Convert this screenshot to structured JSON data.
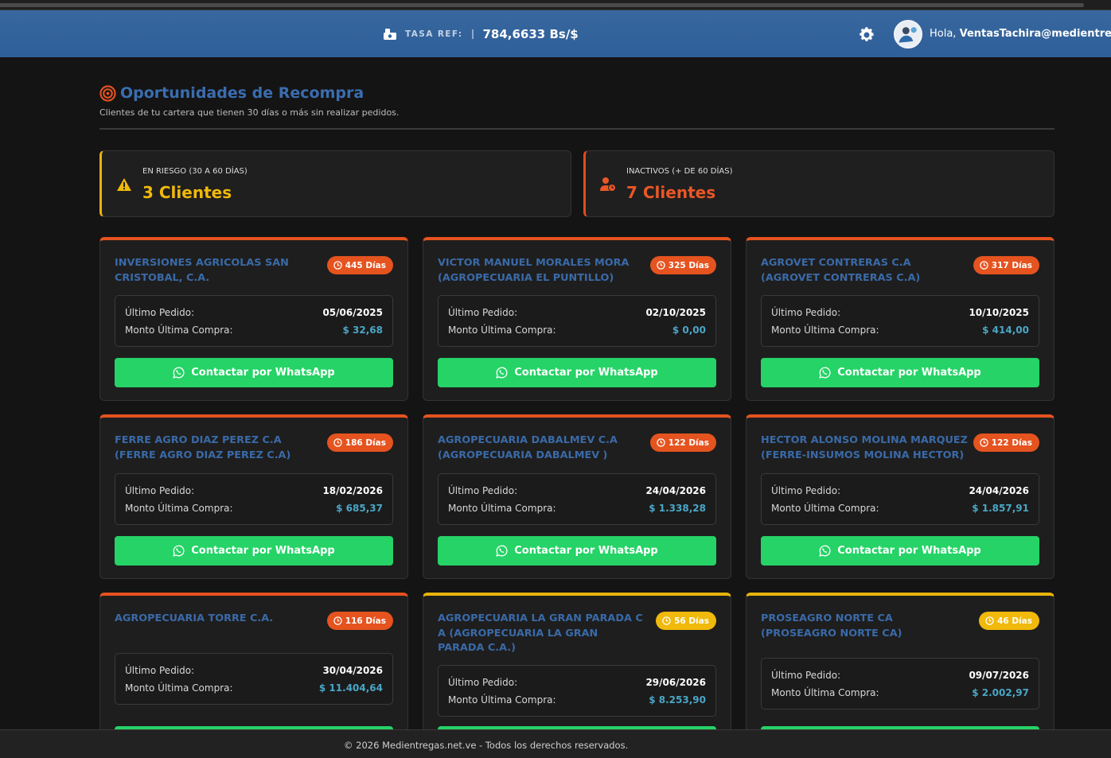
{
  "header": {
    "rate_label": "TASA REF:",
    "rate_value": "784,6633 Bs/$",
    "greeting_prefix": "Hola,",
    "user": "VentasTachira@medientregas"
  },
  "page": {
    "title": "Oportunidades de Recompra",
    "subtitle": "Clientes de tu cartera que tienen 30 días o más sin realizar pedidos."
  },
  "stats": {
    "risk_label": "EN RIESGO (30 A 60 DÍAS)",
    "risk_value": "3 Clientes",
    "inactive_label": "INACTIVOS (+ DE 60 DÍAS)",
    "inactive_value": "7 Clientes"
  },
  "labels": {
    "last_order": "Último Pedido:",
    "last_amount": "Monto Última Compra:",
    "whatsapp": "Contactar por WhatsApp"
  },
  "clients": [
    {
      "name": "INVERSIONES AGRICOLAS SAN CRISTOBAL, C.A.",
      "days": "445 Días",
      "date": "05/06/2025",
      "amount": "$ 32,68"
    },
    {
      "name": "VICTOR MANUEL MORALES MORA (AGROPECUARIA EL PUNTILLO)",
      "days": "325 Días",
      "date": "02/10/2025",
      "amount": "$ 0,00"
    },
    {
      "name": "AGROVET CONTRERAS C.A (AGROVET CONTRERAS C.A)",
      "days": "317 Días",
      "date": "10/10/2025",
      "amount": "$ 414,00"
    },
    {
      "name": "FERRE AGRO DIAZ PEREZ C.A (FERRE AGRO DIAZ PEREZ C.A)",
      "days": "186 Días",
      "date": "18/02/2026",
      "amount": "$ 685,37"
    },
    {
      "name": "AGROPECUARIA DABALMEV C.A (AGROPECUARIA DABALMEV )",
      "days": "122 Días",
      "date": "24/04/2026",
      "amount": "$ 1.338,28"
    },
    {
      "name": "HECTOR ALONSO MOLINA MARQUEZ (FERRE-INSUMOS MOLINA HECTOR)",
      "days": "122 Días",
      "date": "24/04/2026",
      "amount": "$ 1.857,91"
    },
    {
      "name": "AGROPECUARIA TORRE C.A.",
      "days": "116 Días",
      "date": "30/04/2026",
      "amount": "$ 11.404,64"
    },
    {
      "name": "AGROPECUARIA LA GRAN PARADA C A (AGROPECUARIA LA GRAN PARADA C.A.)",
      "days": "56 Días",
      "date": "29/06/2026",
      "amount": "$ 8.253,90"
    },
    {
      "name": "PROSEAGRO NORTE CA (PROSEAGRO NORTE CA)",
      "days": "46 Días",
      "date": "09/07/2026",
      "amount": "$ 2.002,97"
    }
  ],
  "footer": "© 2026 Medientregas.net.ve - Todos los derechos reservados.",
  "colors": {
    "header": "#3465a4",
    "accent_blue": "#3a6db0",
    "danger": "#e5531f",
    "warning": "#f0b90b",
    "whatsapp": "#25d366",
    "money": "#4aa6c6"
  },
  "icons": [
    "money-icon",
    "gear-icon",
    "avatar",
    "target-icon",
    "warning-icon",
    "user-clock-icon",
    "clock-icon",
    "whatsapp-icon"
  ]
}
